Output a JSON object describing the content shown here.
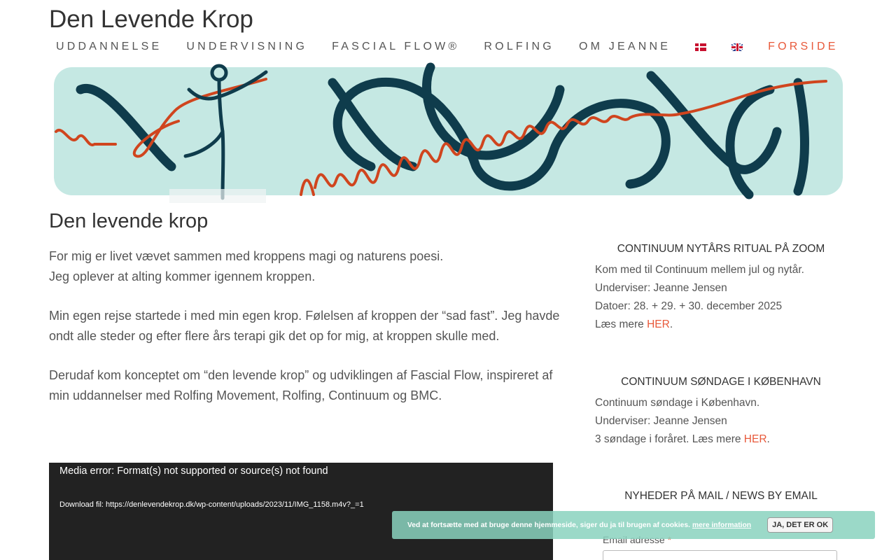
{
  "site": {
    "title": "Den Levende Krop"
  },
  "nav": {
    "items": [
      "UDDANNELSE",
      "UNDERVISNING",
      "FASCIAL FLOW®",
      "ROLFING",
      "OM JEANNE"
    ],
    "active": "FORSIDE",
    "flags": [
      "danish-flag-icon",
      "english-flag-icon"
    ]
  },
  "banner": {
    "icon": "dancer-illustration-banner",
    "colors": {
      "bg": "#c5e8e3",
      "accent": "#d0451e",
      "dark": "#0f3c4c"
    }
  },
  "page": {
    "title": "Den levende krop",
    "paragraphs": [
      "For mig er livet vævet sammen med kroppens magi og naturens poesi.\nJeg oplever at alting kommer igennem kroppen.",
      "Min egen rejse startede i med min egen krop. Følelsen af kroppen der “sad fast”. Jeg havde ondt alle steder og efter flere års terapi gik det op for mig, at kroppen skulle med.",
      "Derudaf kom konceptet om “den levende krop” og udviklingen af Fascial Flow, inspireret af min uddannelser med Rolfing Movement, Rolfing, Continuum og BMC."
    ]
  },
  "media": {
    "error": "Media error: Format(s) not supported or source(s) not found",
    "download_label": "Download fil: ",
    "download_link": "https://denlevendekrop.dk/wp-content/uploads/2023/11/IMG_1158.m4v?_=1"
  },
  "sidebar": {
    "w1": {
      "title": "CONTINUUM NYTÅRS RITUAL PÅ ZOOM",
      "line1": "Kom med til Continuum mellem jul og nytår.",
      "line2": "Underviser: Jeanne Jensen",
      "line3": "Datoer: 28. + 29. + 30. december 2025",
      "line4_text": "Læs mere ",
      "line4_link": "HER",
      "line4_end": "."
    },
    "w2": {
      "title": "CONTINUUM SØNDAGE I KØBENHAVN",
      "line1": "Continuum søndage i København.",
      "line2": "Underviser: Jeanne Jensen",
      "line3_text": "3 søndage i foråret. Læs mere ",
      "line3_link": "HER",
      "line3_end": "."
    },
    "w3": {
      "title": "NYHEDER PÅ MAIL / NEWS BY EMAIL",
      "email_label": "Email adresse",
      "required_mark": "*"
    }
  },
  "cookie": {
    "text": "Ved at fortsætte med at bruge denne hjemmeside, siger du ja til brugen af cookies.",
    "link": "mere information",
    "button": "JA, DET ER OK",
    "color": "#89d2be"
  }
}
